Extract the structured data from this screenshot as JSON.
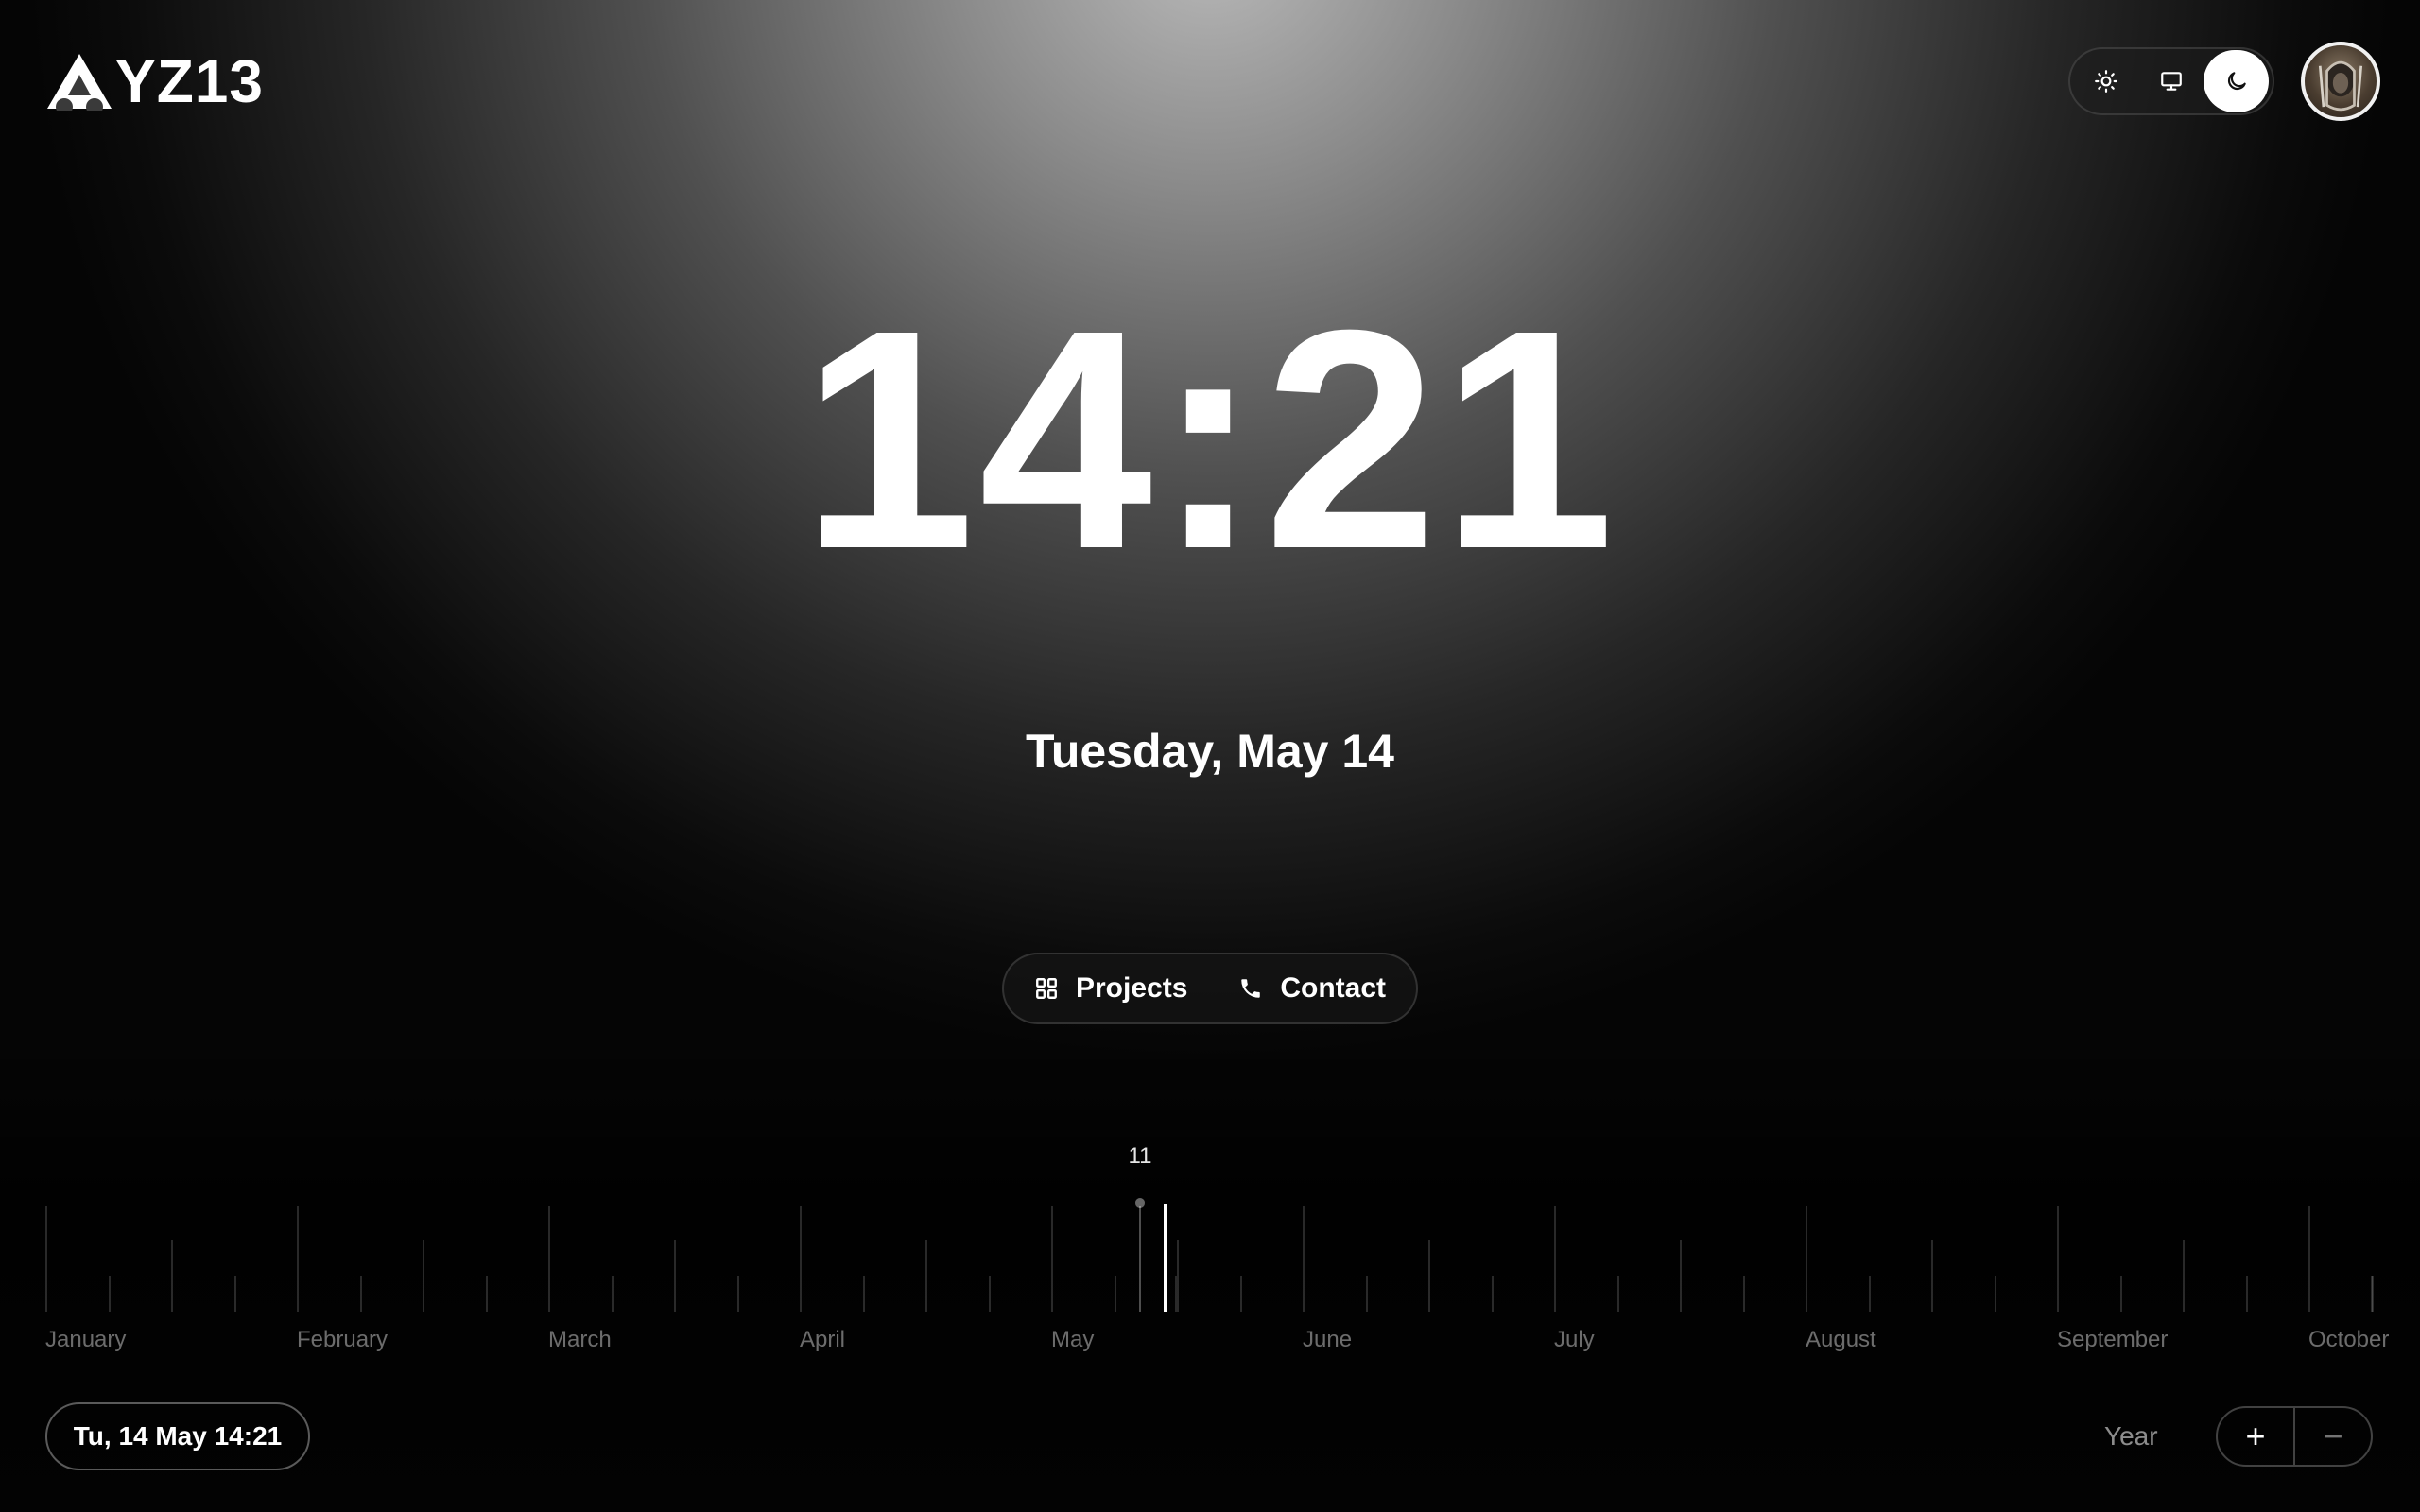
{
  "brand": {
    "name": "YZ13"
  },
  "theme": {
    "options": [
      "light",
      "system",
      "dark"
    ],
    "selected": "dark"
  },
  "clock": {
    "time": "14:21",
    "date_long": "Tuesday, May 14"
  },
  "nav": {
    "projects_label": "Projects",
    "contact_label": "Contact"
  },
  "timeline": {
    "months": [
      "January",
      "February",
      "March",
      "April",
      "May",
      "June",
      "July",
      "August",
      "September",
      "October"
    ],
    "hover_day_label": "11",
    "current_position": "14 May"
  },
  "footer": {
    "current_datetime": "Tu, 14 May 14:21",
    "scale_label": "Year",
    "zoom_in": "+",
    "zoom_out": "−"
  },
  "icons": {
    "logo": "triangle-logo-icon",
    "light": "sun-icon",
    "system": "monitor-icon",
    "dark": "moon-icon",
    "projects": "grid-icon",
    "contact": "phone-icon"
  }
}
